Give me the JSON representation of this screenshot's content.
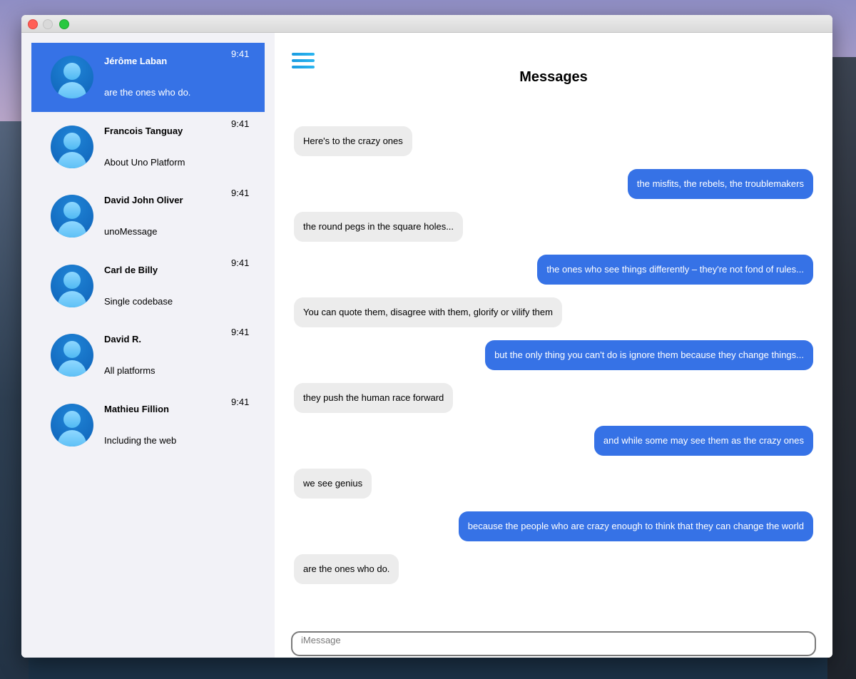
{
  "window": {
    "title": ""
  },
  "header": {
    "title": "Messages"
  },
  "colors": {
    "accent": "#3672e6",
    "incoming_bubble": "#ececec",
    "sidebar_bg": "#f2f2f7"
  },
  "contacts": [
    {
      "name": "Jérôme Laban",
      "time": "9:41",
      "preview": "are the ones who do.",
      "selected": true
    },
    {
      "name": "Francois Tanguay",
      "time": "9:41",
      "preview": "About Uno Platform"
    },
    {
      "name": "David John Oliver",
      "time": "9:41",
      "preview": "unoMessage"
    },
    {
      "name": "Carl de Billy",
      "time": "9:41",
      "preview": "Single codebase"
    },
    {
      "name": "David R.",
      "time": "9:41",
      "preview": "All platforms"
    },
    {
      "name": "Mathieu Fillion",
      "time": "9:41",
      "preview": "Including the web"
    }
  ],
  "messages": [
    {
      "text": "Here's to the crazy ones",
      "direction": "incoming"
    },
    {
      "text": "the misfits, the rebels, the troublemakers",
      "direction": "outgoing"
    },
    {
      "text": "the round pegs in the square holes...",
      "direction": "incoming"
    },
    {
      "text": "the ones who see things differently – they're not fond of rules...",
      "direction": "outgoing"
    },
    {
      "text": "You can quote them, disagree with them, glorify or vilify them",
      "direction": "incoming"
    },
    {
      "text": "but the only thing you can't do is ignore them because they change things...",
      "direction": "outgoing"
    },
    {
      "text": "they push the human race forward",
      "direction": "incoming"
    },
    {
      "text": "and while some may see them as the crazy ones",
      "direction": "outgoing"
    },
    {
      "text": "we see genius",
      "direction": "incoming"
    },
    {
      "text": "because the people who are crazy enough to think that they can change the world",
      "direction": "outgoing"
    },
    {
      "text": "are the ones who do.",
      "direction": "incoming"
    }
  ],
  "composer": {
    "placeholder": "iMessage",
    "value": ""
  },
  "icons": {
    "menu": "hamburger-menu-icon",
    "avatar": "person-avatar-icon"
  }
}
